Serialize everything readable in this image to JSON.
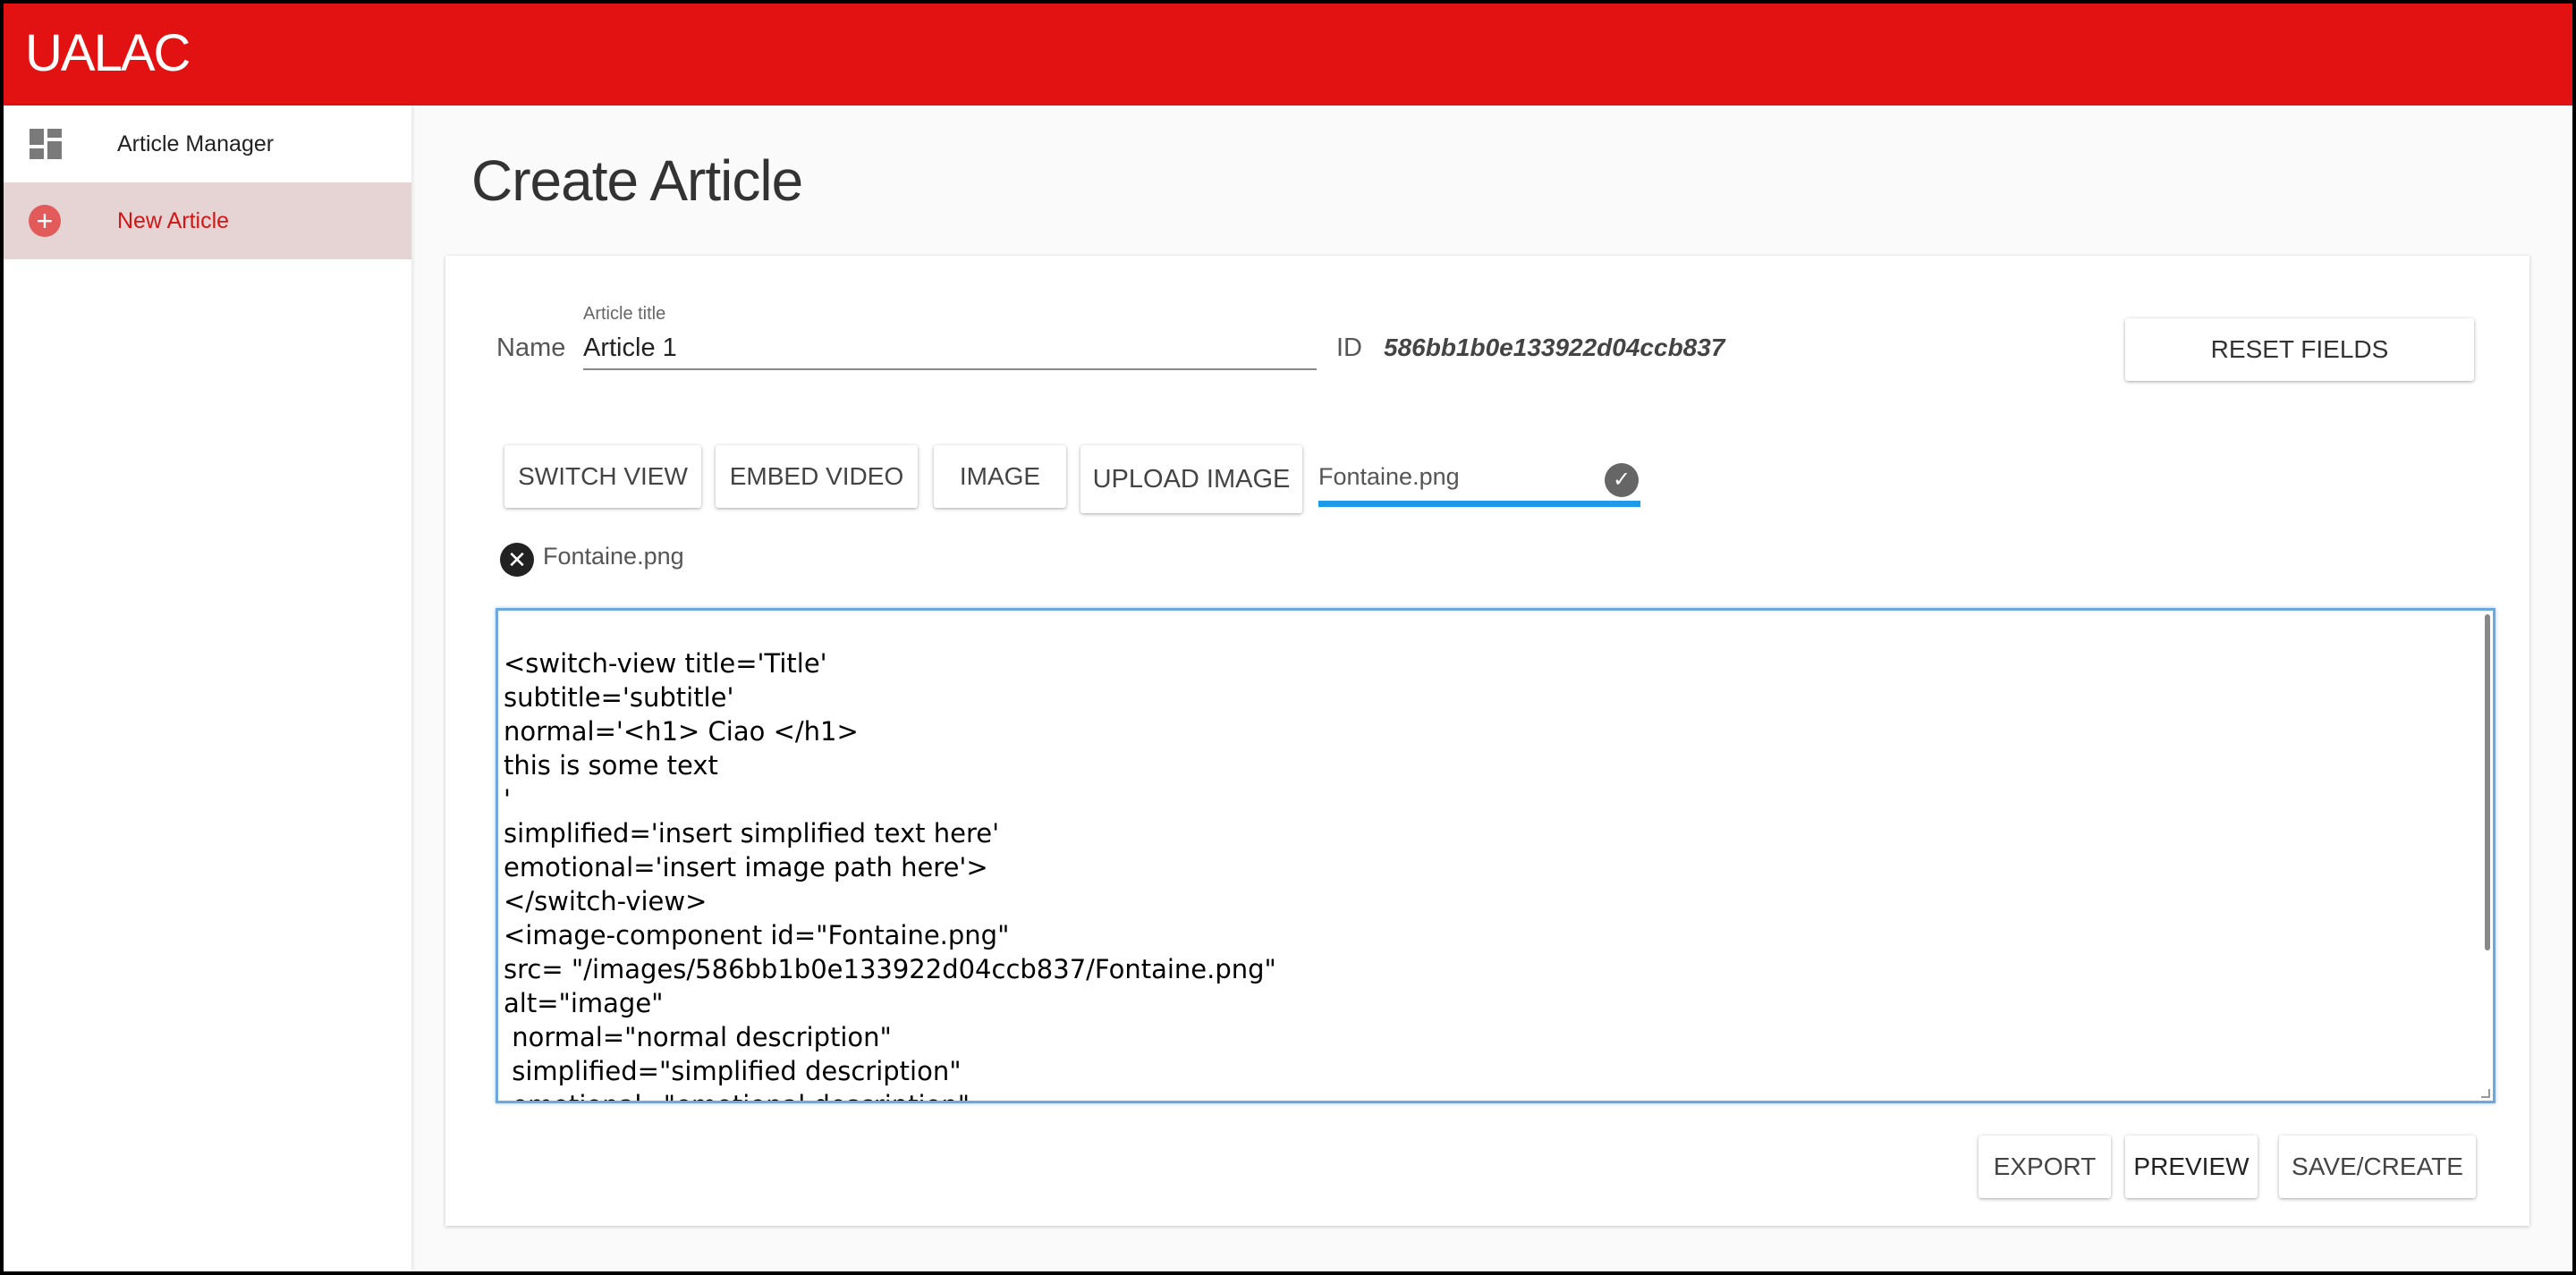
{
  "app": {
    "brand": "UALAC"
  },
  "sidebar": {
    "items": [
      {
        "label": "Article Manager",
        "icon": "dashboard-icon",
        "active": false
      },
      {
        "label": "New Article",
        "icon": "add-circle-icon",
        "active": true
      }
    ]
  },
  "main": {
    "title": "Create Article",
    "form": {
      "name_label": "Name",
      "title_label": "Article title",
      "title_value": "Article 1",
      "id_label": "ID",
      "id_value": "586bb1b0e133922d04ccb837",
      "reset_label": "RESET FIELDS"
    },
    "toolbar": {
      "switch_view": "SWITCH VIEW",
      "embed_video": "EMBED VIDEO",
      "image": "IMAGE",
      "upload_image": "UPLOAD IMAGE",
      "file_name": "Fontaine.png"
    },
    "attachment": {
      "name": "Fontaine.png"
    },
    "editor": {
      "content": "<switch-view title='Title'\nsubtitle='subtitle'\nnormal='<h1> Ciao </h1>\nthis is some text\n'\nsimplified='insert simplified text here'\nemotional='insert image path here'>\n</switch-view>\n<image-component id=\"Fontaine.png\"\nsrc= \"/images/586bb1b0e133922d04ccb837/Fontaine.png\"\nalt=\"image\"\n normal=\"normal description\"\n simplified=\"simplified description\"\n emotional=\"emotional description\""
    },
    "actions": {
      "export": "EXPORT",
      "preview": "PREVIEW",
      "save_create": "SAVE/CREATE"
    }
  },
  "colors": {
    "header": "#e21212",
    "active_nav_bg": "#e6d3d4",
    "active_nav_text": "#d11616",
    "upload_progress": "#1e9be8",
    "editor_focus_border": "#6ca7dd"
  }
}
